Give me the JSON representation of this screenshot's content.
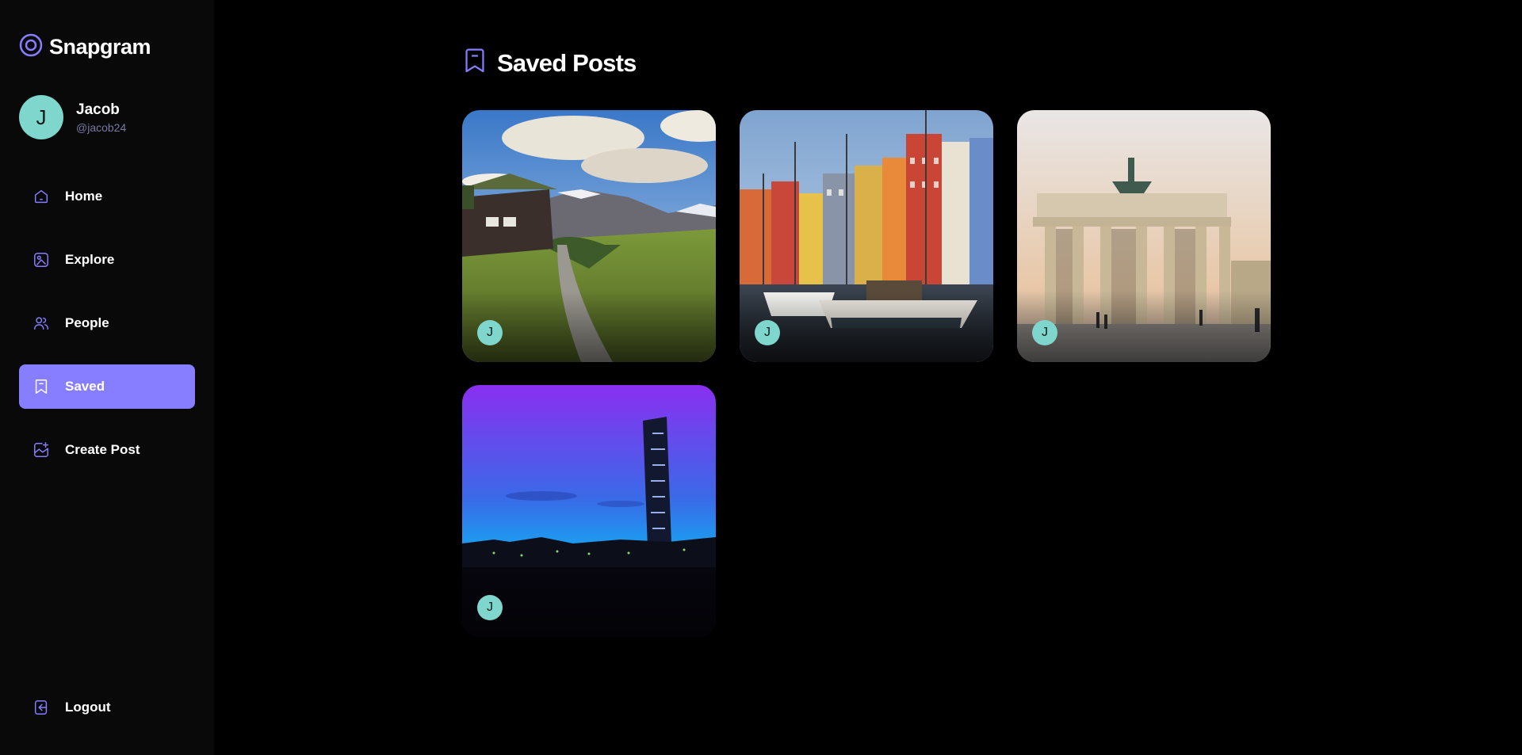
{
  "app": {
    "name": "Snapgram",
    "accent": "#877eff",
    "avatar_color": "#7fd6cc"
  },
  "user": {
    "name": "Jacob",
    "handle": "@jacob24",
    "initial": "J"
  },
  "nav": {
    "items": [
      {
        "label": "Home",
        "icon": "home-icon",
        "active": false
      },
      {
        "label": "Explore",
        "icon": "explore-icon",
        "active": false
      },
      {
        "label": "People",
        "icon": "people-icon",
        "active": false
      },
      {
        "label": "Saved",
        "icon": "bookmark-icon",
        "active": true
      },
      {
        "label": "Create Post",
        "icon": "create-post-icon",
        "active": false
      }
    ],
    "logout_label": "Logout"
  },
  "page": {
    "title": "Saved Posts",
    "title_icon": "bookmark-icon"
  },
  "posts": [
    {
      "scene": "mountain-cabin-path",
      "author_initial": "J"
    },
    {
      "scene": "harbor-boats-colorful-houses",
      "author_initial": "J"
    },
    {
      "scene": "brandenburg-gate",
      "author_initial": "J"
    },
    {
      "scene": "twisting-tower-dusk",
      "author_initial": "J"
    }
  ]
}
